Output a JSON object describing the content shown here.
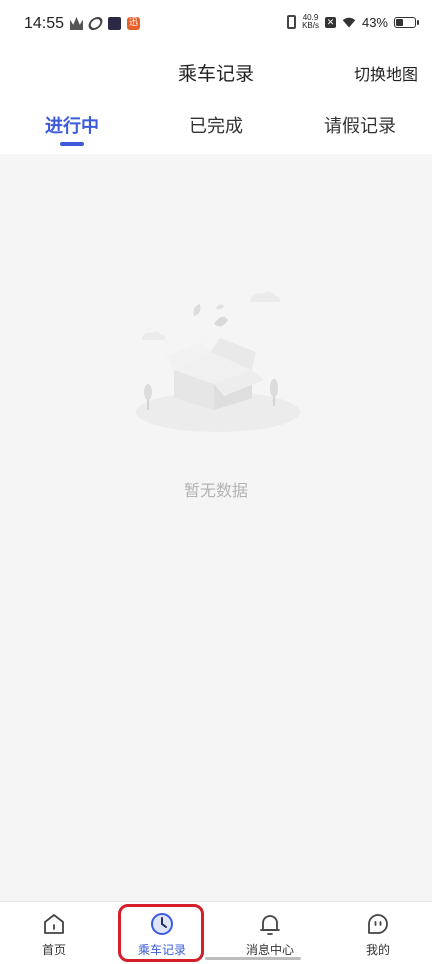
{
  "status_bar": {
    "time": "14:55",
    "left_icons": [
      "crown-icon",
      "loop-icon",
      "play-icon",
      "app-badge-icon"
    ],
    "app_badge_text": "迅",
    "net_speed_value": "40.9",
    "net_speed_unit": "KB/s",
    "x_badge": "✕",
    "battery_percent": "43%",
    "battery_level": 0.43
  },
  "header": {
    "title": "乘车记录",
    "action": "切换地图"
  },
  "tabs": [
    {
      "label": "进行中",
      "active": true
    },
    {
      "label": "已完成",
      "active": false
    },
    {
      "label": "请假记录",
      "active": false
    }
  ],
  "empty_state": {
    "text": "暂无数据"
  },
  "bottom_nav": [
    {
      "label": "首页",
      "icon": "home-icon",
      "active": false
    },
    {
      "label": "乘车记录",
      "icon": "clock-icon",
      "active": true
    },
    {
      "label": "消息中心",
      "icon": "bell-icon",
      "active": false
    },
    {
      "label": "我的",
      "icon": "profile-icon",
      "active": false
    }
  ],
  "colors": {
    "accent": "#3b5bd9",
    "highlight": "#d41f2a",
    "background": "#f5f5f5",
    "muted_text": "#b4b4b4"
  }
}
